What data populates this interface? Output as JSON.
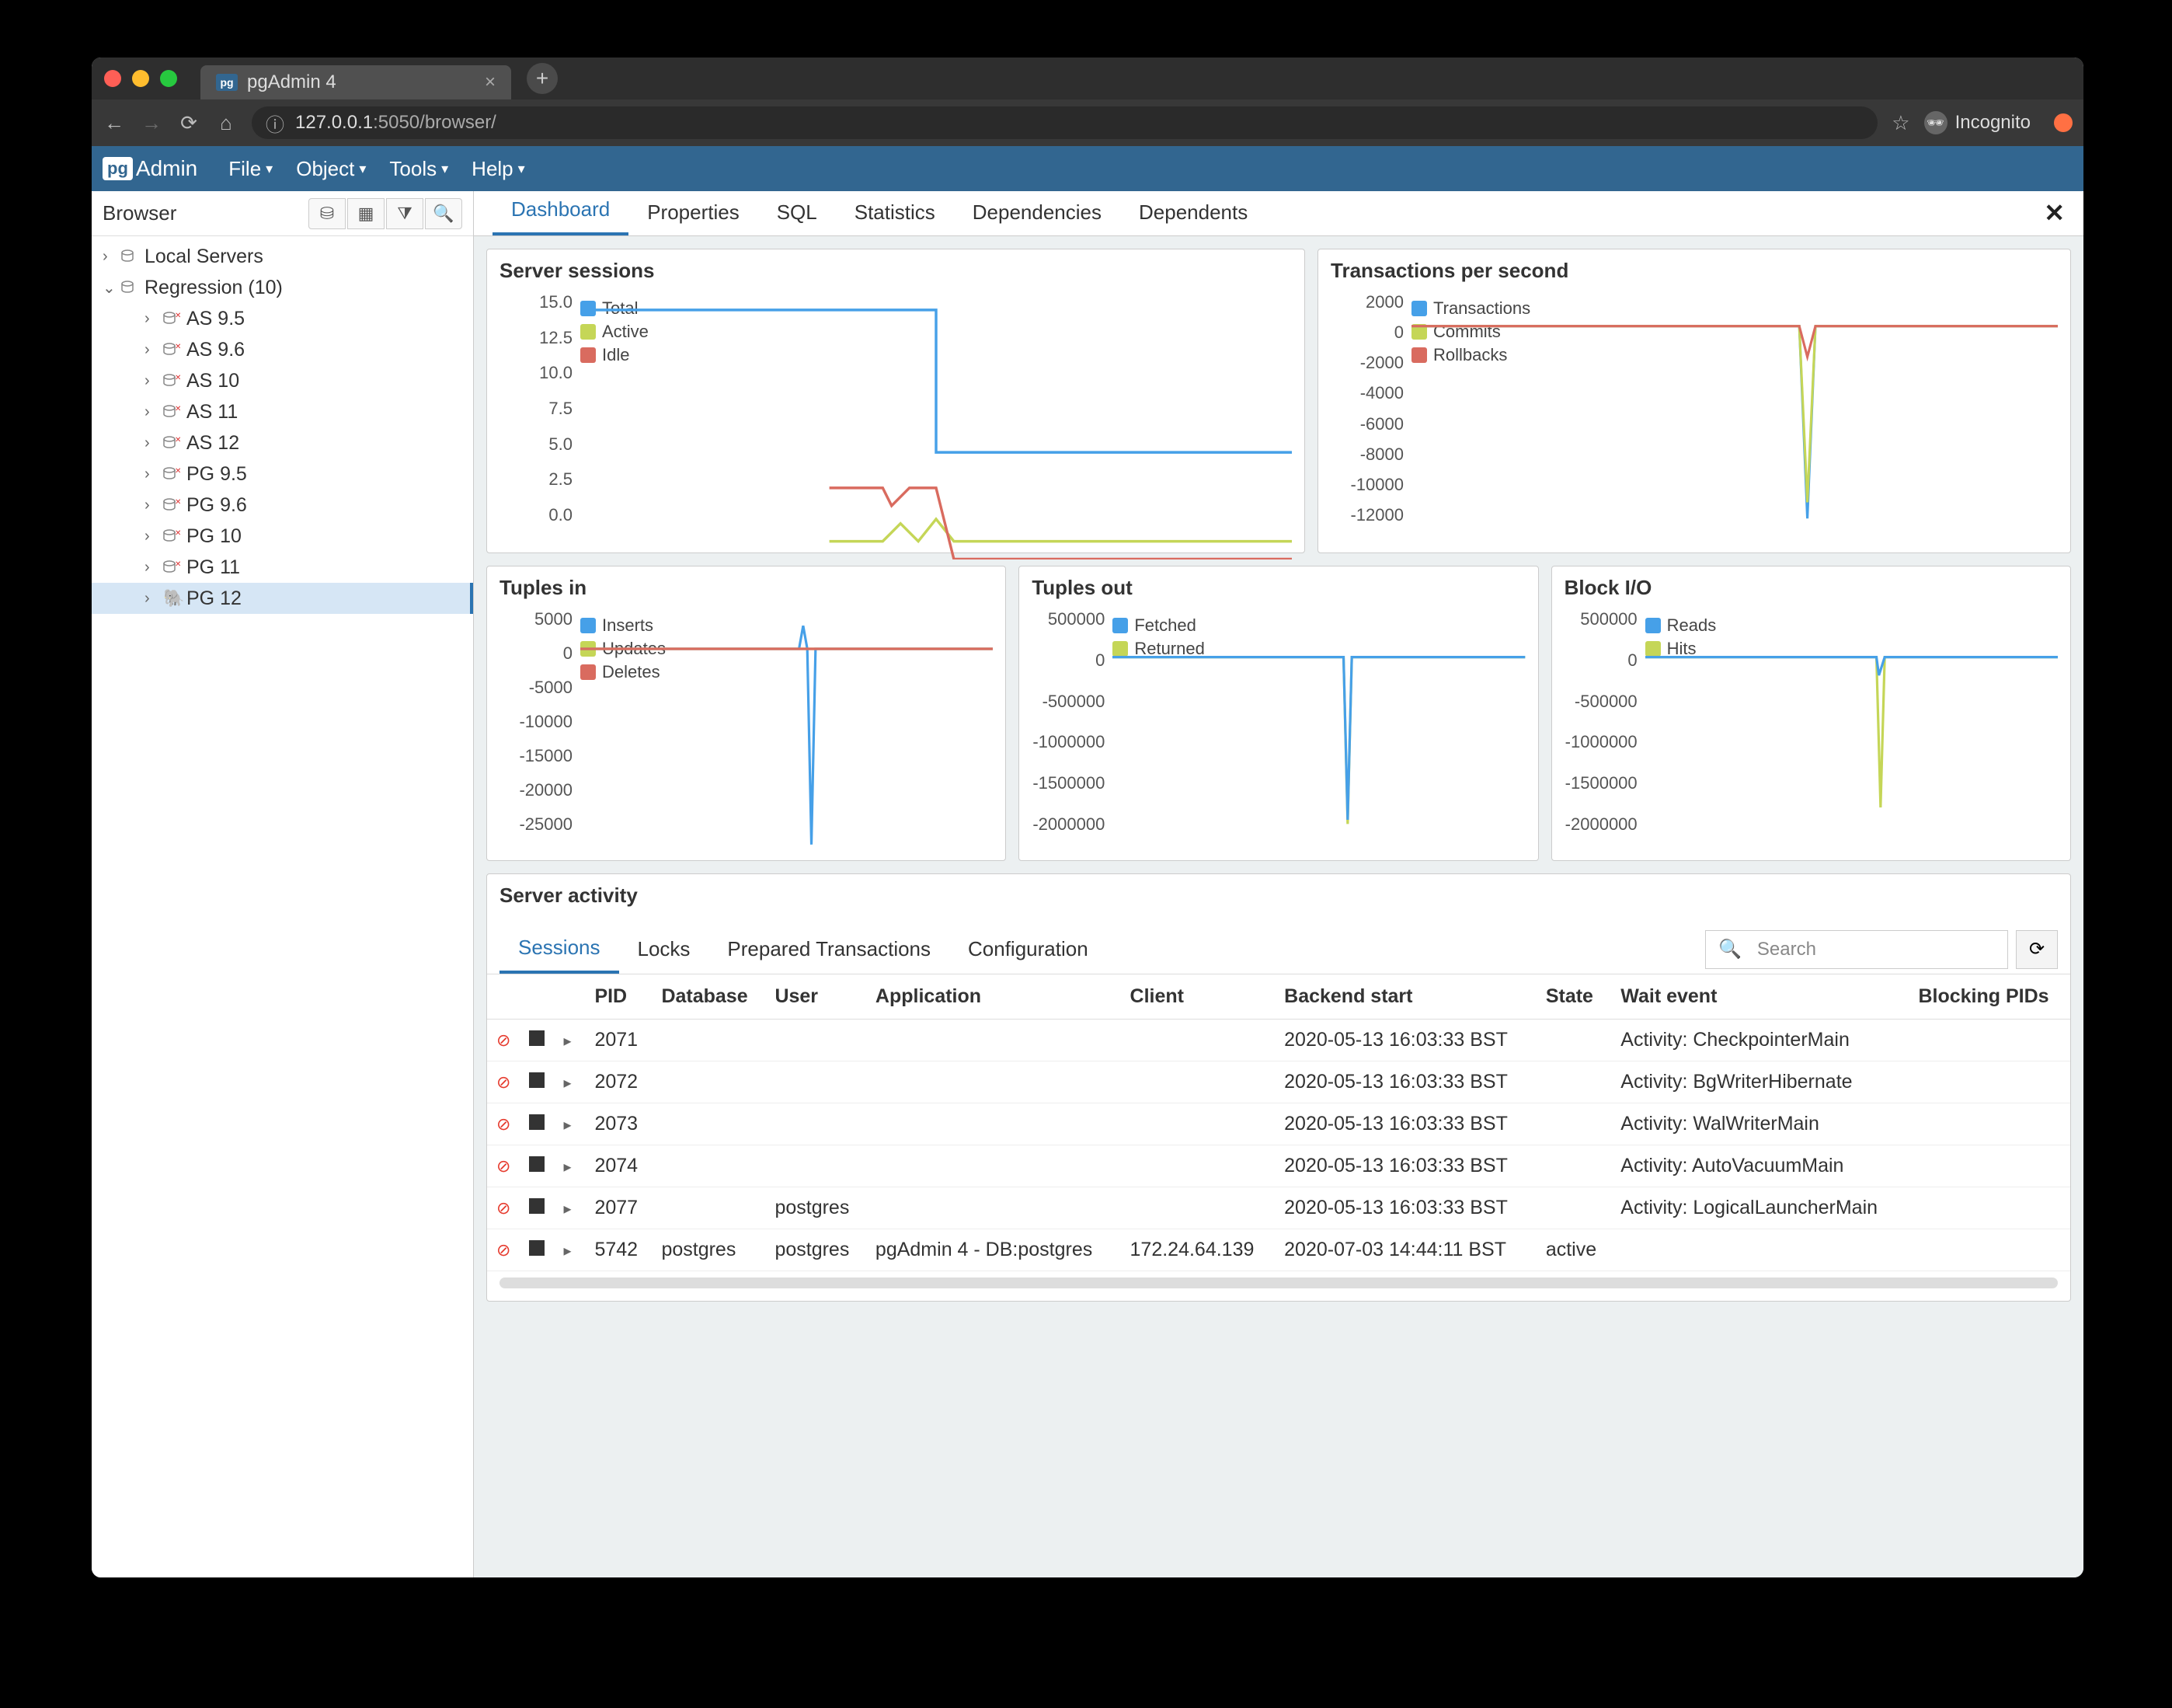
{
  "browser": {
    "tab_title": "pgAdmin 4",
    "url_host": "127.0.0.1",
    "url_port": ":5050",
    "url_path": "/browser/",
    "incognito_label": "Incognito"
  },
  "app": {
    "logo_prefix": "pg",
    "logo_text": "Admin",
    "menus": [
      "File",
      "Object",
      "Tools",
      "Help"
    ]
  },
  "sidebar": {
    "title": "Browser",
    "groups": [
      {
        "label": "Local Servers",
        "expanded": false
      },
      {
        "label": "Regression (10)",
        "expanded": true,
        "children": [
          "AS 9.5",
          "AS 9.6",
          "AS 10",
          "AS 11",
          "AS 12",
          "PG 9.5",
          "PG 9.6",
          "PG 10",
          "PG 11",
          "PG 12"
        ]
      }
    ],
    "selected": "PG 12"
  },
  "main_tabs": [
    "Dashboard",
    "Properties",
    "SQL",
    "Statistics",
    "Dependencies",
    "Dependents"
  ],
  "main_tab_active": "Dashboard",
  "charts": {
    "sessions": {
      "title": "Server sessions",
      "legend": [
        "Total",
        "Active",
        "Idle"
      ],
      "yticks": [
        "15.0",
        "12.5",
        "10.0",
        "7.5",
        "5.0",
        "2.5",
        "0.0"
      ]
    },
    "tps": {
      "title": "Transactions per second",
      "legend": [
        "Transactions",
        "Commits",
        "Rollbacks"
      ],
      "yticks": [
        "2000",
        "0",
        "-2000",
        "-4000",
        "-6000",
        "-8000",
        "-10000",
        "-12000"
      ]
    },
    "tin": {
      "title": "Tuples in",
      "legend": [
        "Inserts",
        "Updates",
        "Deletes"
      ],
      "yticks": [
        "5000",
        "0",
        "-5000",
        "-10000",
        "-15000",
        "-20000",
        "-25000"
      ]
    },
    "tout": {
      "title": "Tuples out",
      "legend": [
        "Fetched",
        "Returned"
      ],
      "yticks": [
        "500000",
        "0",
        "-500000",
        "-1000000",
        "-1500000",
        "-2000000"
      ]
    },
    "bio": {
      "title": "Block I/O",
      "legend": [
        "Reads",
        "Hits"
      ],
      "yticks": [
        "500000",
        "0",
        "-500000",
        "-1000000",
        "-1500000",
        "-2000000"
      ]
    }
  },
  "chart_data": [
    {
      "type": "line",
      "title": "Server sessions",
      "ylim": [
        0,
        15
      ],
      "series": [
        {
          "name": "Total",
          "color": "#46a0e8",
          "values": [
            14,
            14,
            14,
            14,
            14,
            14,
            6,
            6,
            6,
            6,
            6,
            6,
            6
          ]
        },
        {
          "name": "Active",
          "color": "#c5d657",
          "values": [
            1,
            1,
            1,
            1,
            1,
            2,
            1,
            1,
            1,
            1,
            1,
            1,
            1
          ]
        },
        {
          "name": "Idle",
          "color": "#d96b5f",
          "values": [
            4,
            4,
            4,
            4,
            3,
            4,
            0,
            0,
            0,
            0,
            0,
            0,
            0
          ]
        }
      ]
    },
    {
      "type": "line",
      "title": "Transactions per second",
      "ylim": [
        -12000,
        2000
      ],
      "series": [
        {
          "name": "Transactions",
          "color": "#46a0e8",
          "values": [
            0,
            0,
            0,
            0,
            0,
            0,
            0,
            -11000,
            0,
            0,
            0,
            0,
            0
          ]
        },
        {
          "name": "Commits",
          "color": "#c5d657",
          "values": [
            0,
            0,
            0,
            0,
            0,
            0,
            0,
            -10000,
            0,
            0,
            0,
            0,
            0
          ]
        },
        {
          "name": "Rollbacks",
          "color": "#d96b5f",
          "values": [
            0,
            0,
            0,
            0,
            0,
            0,
            0,
            -1500,
            0,
            0,
            0,
            0,
            0
          ]
        }
      ]
    },
    {
      "type": "line",
      "title": "Tuples in",
      "ylim": [
        -25000,
        5000
      ],
      "series": [
        {
          "name": "Inserts",
          "color": "#46a0e8",
          "values": [
            0,
            0,
            0,
            0,
            0,
            2000,
            -24000,
            0,
            0,
            0,
            0,
            0,
            0
          ]
        },
        {
          "name": "Updates",
          "color": "#c5d657",
          "values": [
            0,
            0,
            0,
            0,
            0,
            0,
            0,
            0,
            0,
            0,
            0,
            0,
            0
          ]
        },
        {
          "name": "Deletes",
          "color": "#d96b5f",
          "values": [
            0,
            0,
            0,
            0,
            0,
            0,
            0,
            0,
            0,
            0,
            0,
            0,
            0
          ]
        }
      ]
    },
    {
      "type": "line",
      "title": "Tuples out",
      "ylim": [
        -2000000,
        500000
      ],
      "series": [
        {
          "name": "Fetched",
          "color": "#46a0e8",
          "values": [
            0,
            0,
            0,
            0,
            0,
            0,
            -1700000,
            0,
            0,
            0,
            0,
            0,
            0
          ]
        },
        {
          "name": "Returned",
          "color": "#c5d657",
          "values": [
            0,
            0,
            0,
            0,
            0,
            0,
            -1700000,
            0,
            0,
            0,
            0,
            0,
            0
          ]
        }
      ]
    },
    {
      "type": "line",
      "title": "Block I/O",
      "ylim": [
        -2000000,
        500000
      ],
      "series": [
        {
          "name": "Reads",
          "color": "#46a0e8",
          "values": [
            0,
            0,
            0,
            0,
            0,
            0,
            -100000,
            0,
            0,
            0,
            0,
            0,
            0
          ]
        },
        {
          "name": "Hits",
          "color": "#c5d657",
          "values": [
            0,
            0,
            0,
            0,
            0,
            0,
            -1600000,
            0,
            0,
            0,
            0,
            0,
            0
          ]
        }
      ]
    }
  ],
  "activity": {
    "title": "Server activity",
    "tabs": [
      "Sessions",
      "Locks",
      "Prepared Transactions",
      "Configuration"
    ],
    "tab_active": "Sessions",
    "search_placeholder": "Search",
    "columns": [
      "PID",
      "Database",
      "User",
      "Application",
      "Client",
      "Backend start",
      "State",
      "Wait event",
      "Blocking PIDs"
    ],
    "rows": [
      {
        "pid": "2071",
        "db": "",
        "user": "",
        "app": "",
        "client": "",
        "start": "2020-05-13 16:03:33 BST",
        "state": "",
        "wait": "Activity: CheckpointerMain",
        "block": ""
      },
      {
        "pid": "2072",
        "db": "",
        "user": "",
        "app": "",
        "client": "",
        "start": "2020-05-13 16:03:33 BST",
        "state": "",
        "wait": "Activity: BgWriterHibernate",
        "block": ""
      },
      {
        "pid": "2073",
        "db": "",
        "user": "",
        "app": "",
        "client": "",
        "start": "2020-05-13 16:03:33 BST",
        "state": "",
        "wait": "Activity: WalWriterMain",
        "block": ""
      },
      {
        "pid": "2074",
        "db": "",
        "user": "",
        "app": "",
        "client": "",
        "start": "2020-05-13 16:03:33 BST",
        "state": "",
        "wait": "Activity: AutoVacuumMain",
        "block": ""
      },
      {
        "pid": "2077",
        "db": "",
        "user": "postgres",
        "app": "",
        "client": "",
        "start": "2020-05-13 16:03:33 BST",
        "state": "",
        "wait": "Activity: LogicalLauncherMain",
        "block": ""
      },
      {
        "pid": "5742",
        "db": "postgres",
        "user": "postgres",
        "app": "pgAdmin 4 - DB:postgres",
        "client": "172.24.64.139",
        "start": "2020-07-03 14:44:11 BST",
        "state": "active",
        "wait": "",
        "block": ""
      }
    ]
  }
}
